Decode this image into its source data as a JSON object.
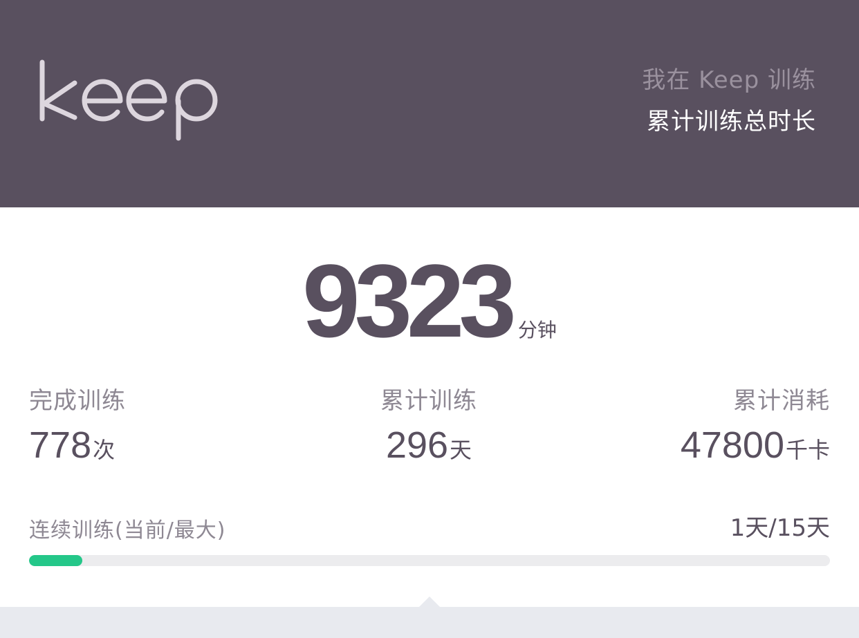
{
  "header": {
    "logo_text": "keep",
    "line1": "我在 Keep 训练",
    "line2": "累计训练总时长",
    "background_color": "#59505f"
  },
  "total": {
    "value": "9323",
    "unit": "分钟"
  },
  "stats": [
    {
      "label": "完成训练",
      "value": "778",
      "unit": "次"
    },
    {
      "label": "累计训练",
      "value": "296",
      "unit": "天"
    },
    {
      "label": "累计消耗",
      "value": "47800",
      "unit": "千卡"
    }
  ],
  "streak": {
    "label": "连续训练(当前/最大)",
    "value": "1天/15天",
    "current": 1,
    "max": 15,
    "progress_fraction": 0.0667,
    "fill_color": "#24c789"
  }
}
